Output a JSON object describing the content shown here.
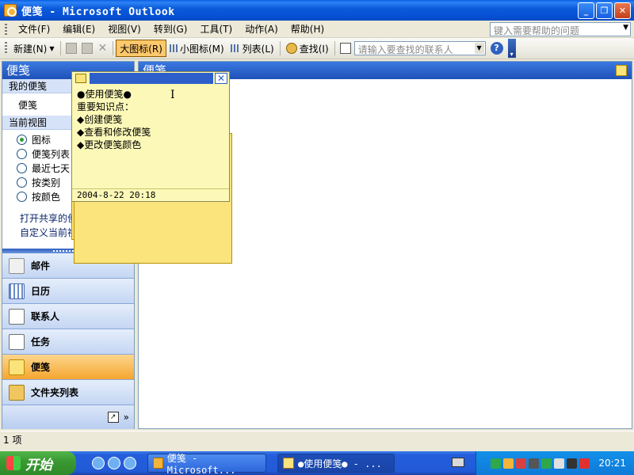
{
  "window": {
    "title": "便笺 - Microsoft Outlook",
    "buttons": {
      "minimize": "_",
      "restore": "❐",
      "close": "✕"
    }
  },
  "menu": {
    "items": [
      "文件(F)",
      "编辑(E)",
      "视图(V)",
      "转到(G)",
      "工具(T)",
      "动作(A)",
      "帮助(H)"
    ],
    "help_placeholder": "键入需要帮助的问题"
  },
  "toolbar": {
    "new_label": "新建(N)",
    "large_icons_label": "大图标(R)",
    "small_icons_label": "小图标(M)",
    "list_label": "列表(L)",
    "find_label": "查找(I)",
    "contact_placeholder": "请输入要查找的联系人",
    "help_glyph": "?"
  },
  "nav": {
    "header": "便笺",
    "my_notes_section": "我的便笺",
    "my_notes_folder": "便笺",
    "current_view_section": "当前视图",
    "views": [
      {
        "label": "图标",
        "selected": true
      },
      {
        "label": "便笺列表",
        "selected": false
      },
      {
        "label": "最近七天",
        "selected": false
      },
      {
        "label": "按类别",
        "selected": false
      },
      {
        "label": "按颜色",
        "selected": false
      }
    ],
    "links": [
      "打开共享的便笺...",
      "自定义当前视图..."
    ],
    "buttons": [
      {
        "label": "邮件",
        "icon": "mail-icon",
        "active": false
      },
      {
        "label": "日历",
        "icon": "calendar-icon",
        "active": false
      },
      {
        "label": "联系人",
        "icon": "contacts-icon",
        "active": false
      },
      {
        "label": "任务",
        "icon": "tasks-icon",
        "active": false
      },
      {
        "label": "便笺",
        "icon": "notes-icon",
        "active": true
      },
      {
        "label": "文件夹列表",
        "icon": "folder-icon",
        "active": false
      }
    ],
    "footer_more": "»"
  },
  "main": {
    "header": "便笺"
  },
  "note": {
    "lines": [
      "●使用便笺●",
      "重要知识点：",
      "◆创建便笺",
      "◆查看和修改便笺",
      "◆更改便笺颜色"
    ],
    "date": "2004-8-22 20:18",
    "close_glyph": "✕"
  },
  "status": {
    "text": "1 项"
  },
  "taskbar": {
    "start_label": "开始",
    "tasks": [
      {
        "label": "便笺 - Microsoft...",
        "active": false
      },
      {
        "label": "●使用便笺● - ...",
        "active": true
      }
    ],
    "clock": "20:21"
  }
}
